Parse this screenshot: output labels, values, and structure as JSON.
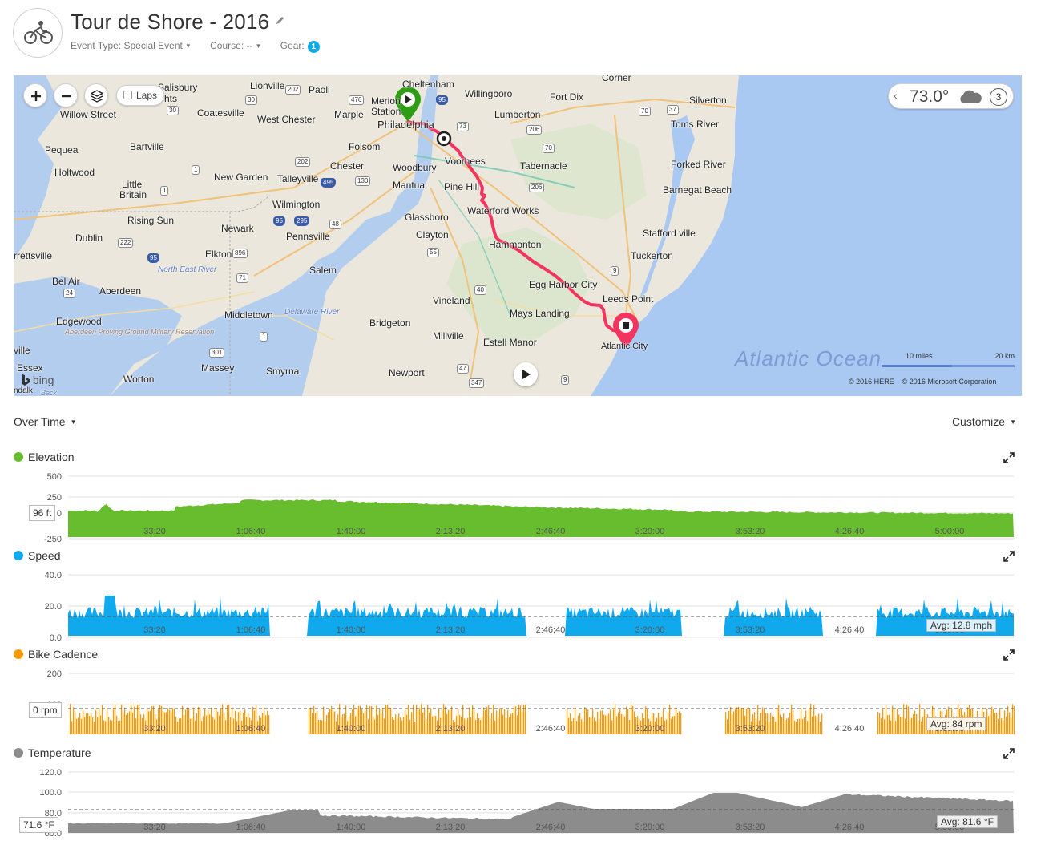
{
  "header": {
    "title": "Tour de Shore - 2016",
    "event_type_label": "Event Type: Special Event",
    "course_label": "Course: --",
    "gear_label": "Gear:",
    "gear_count": "1"
  },
  "map": {
    "controls": {
      "laps_label": "Laps"
    },
    "weather": {
      "temperature": "73.0°",
      "count": "3"
    },
    "ocean_label": "Atlantic Ocean",
    "scale": {
      "miles": "10 miles",
      "km": "20 km"
    },
    "copyright": [
      "© 2016 HERE",
      "© 2016 Microsoft Corporation"
    ],
    "provider": "bing",
    "labels": [
      {
        "text": "Lionville"
      },
      {
        "text": "Paoli"
      },
      {
        "text": "Cheltenham"
      },
      {
        "text": "Willingboro"
      },
      {
        "text": "Corner"
      },
      {
        "text": "Fort Dix"
      },
      {
        "text": "Silverton"
      },
      {
        "text": "Toms River"
      },
      {
        "text": "Willow Street"
      },
      {
        "text": "Coatesville"
      },
      {
        "text": "West Chester"
      },
      {
        "text": "Marple"
      },
      {
        "text": "Philadelphia"
      },
      {
        "text": "Lumberton"
      },
      {
        "text": "Pequea"
      },
      {
        "text": "Bartville"
      },
      {
        "text": "Folsom"
      },
      {
        "text": "Voorhees"
      },
      {
        "text": "Tabernacle"
      },
      {
        "text": "Forked River"
      },
      {
        "text": "Holtwood"
      },
      {
        "text": "New Garden"
      },
      {
        "text": "Chester"
      },
      {
        "text": "Woodbury"
      },
      {
        "text": "Talleyville"
      },
      {
        "text": "Mantua"
      },
      {
        "text": "Pine Hill"
      },
      {
        "text": "Barnegat Beach"
      },
      {
        "text": "Little"
      },
      {
        "text": "Britain"
      },
      {
        "text": "Wilmington"
      },
      {
        "text": "Waterford Works"
      },
      {
        "text": "Rising Sun"
      },
      {
        "text": "Glassboro"
      },
      {
        "text": "Stafford ville"
      },
      {
        "text": "Newark"
      },
      {
        "text": "Dublin"
      },
      {
        "text": "Pennsville"
      },
      {
        "text": "Clayton"
      },
      {
        "text": "Hammonton"
      },
      {
        "text": "rrettsville"
      },
      {
        "text": "Elkton"
      },
      {
        "text": "Tuckerton"
      },
      {
        "text": "Salem"
      },
      {
        "text": "Bel Air"
      },
      {
        "text": "Aberdeen"
      },
      {
        "text": "Egg Harbor City"
      },
      {
        "text": "Vineland"
      },
      {
        "text": "Leeds Point"
      },
      {
        "text": "Middletown"
      },
      {
        "text": "Mays Landing"
      },
      {
        "text": "Edgewood"
      },
      {
        "text": "Bridgeton"
      },
      {
        "text": "Millville"
      },
      {
        "text": "Estell Manor"
      },
      {
        "text": "Atlantic City"
      },
      {
        "text": "ville"
      },
      {
        "text": "Massey"
      },
      {
        "text": "Essex"
      },
      {
        "text": "Worton"
      },
      {
        "text": "Smyrna"
      },
      {
        "text": "Newport"
      },
      {
        "text": "ndalk"
      },
      {
        "text": "Back"
      },
      {
        "text": "Station"
      },
      {
        "text": "Merion"
      },
      {
        "text": "Salisbury"
      },
      {
        "text": "hts"
      }
    ],
    "water_labels": [
      "North East River",
      "Delaware River"
    ],
    "military_label": "Aberdeen Proving Ground Military Reservation",
    "shields": [
      "202",
      "30",
      "30",
      "476",
      "95",
      "73",
      "206",
      "70",
      "70",
      "37",
      "202",
      "1",
      "495",
      "130",
      "206",
      "1",
      "95",
      "295",
      "48",
      "222",
      "896",
      "55",
      "9",
      "95",
      "71",
      "40",
      "24",
      "1",
      "301",
      "47",
      "347",
      "9"
    ]
  },
  "section": {
    "over_time_label": "Over Time",
    "customize_label": "Customize"
  },
  "x_ticks": [
    "33:20",
    "1:06:40",
    "1:40:00",
    "2:13:20",
    "2:46:40",
    "3:20:00",
    "3:53:20",
    "4:26:40",
    "5:00:00"
  ],
  "colors": {
    "elevation": "#67bd2d",
    "speed": "#11a9ed",
    "cadence": "#ff9900",
    "temperature": "#8c8c8c",
    "route": "#f2345e",
    "start_marker": "#2f9c16",
    "end_marker": "#f2345e"
  },
  "charts": [
    {
      "key": "elevation",
      "title": "Elevation",
      "y_ticks": [
        "500",
        "250",
        "0",
        "-250"
      ],
      "current_value": "96 ft",
      "avg_label": ""
    },
    {
      "key": "speed",
      "title": "Speed",
      "y_ticks": [
        "40.0",
        "20.0",
        "0.0"
      ],
      "current_value": "",
      "avg_label": "Avg: 12.8 mph"
    },
    {
      "key": "cadence",
      "title": "Bike Cadence",
      "y_ticks": [
        "200",
        "100"
      ],
      "current_value": "0 rpm",
      "avg_label": "Avg: 84 rpm"
    },
    {
      "key": "temperature",
      "title": "Temperature",
      "y_ticks": [
        "120.0",
        "100.0",
        "80.0",
        "60.0"
      ],
      "current_value": "71.6 °F",
      "avg_label": "Avg: 81.6 °F"
    }
  ]
}
